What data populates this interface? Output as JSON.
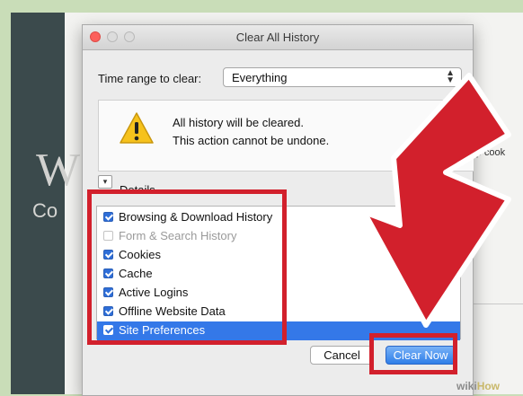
{
  "background": {
    "side_text": "keep cook",
    "watermark_wiki": "wiki",
    "watermark_how": "How"
  },
  "dialog": {
    "title": "Clear All History",
    "time_range_label": "Time range to clear:",
    "time_range_value": "Everything",
    "warning_line1": "All history will be cleared.",
    "warning_line2": "This action cannot be undone.",
    "details_label": "Details",
    "items": [
      {
        "label": "Browsing & Download History",
        "checked": true,
        "enabled": true,
        "selected": false
      },
      {
        "label": "Form & Search History",
        "checked": false,
        "enabled": false,
        "selected": false
      },
      {
        "label": "Cookies",
        "checked": true,
        "enabled": true,
        "selected": false
      },
      {
        "label": "Cache",
        "checked": true,
        "enabled": true,
        "selected": false
      },
      {
        "label": "Active Logins",
        "checked": true,
        "enabled": true,
        "selected": false
      },
      {
        "label": "Offline Website Data",
        "checked": true,
        "enabled": true,
        "selected": false
      },
      {
        "label": "Site Preferences",
        "checked": true,
        "enabled": true,
        "selected": true
      }
    ],
    "cancel_label": "Cancel",
    "clear_label": "Clear Now"
  },
  "colors": {
    "annotation_red": "#d2202c",
    "accent_blue": "#3478e8",
    "warning_yellow": "#f6c21c"
  }
}
